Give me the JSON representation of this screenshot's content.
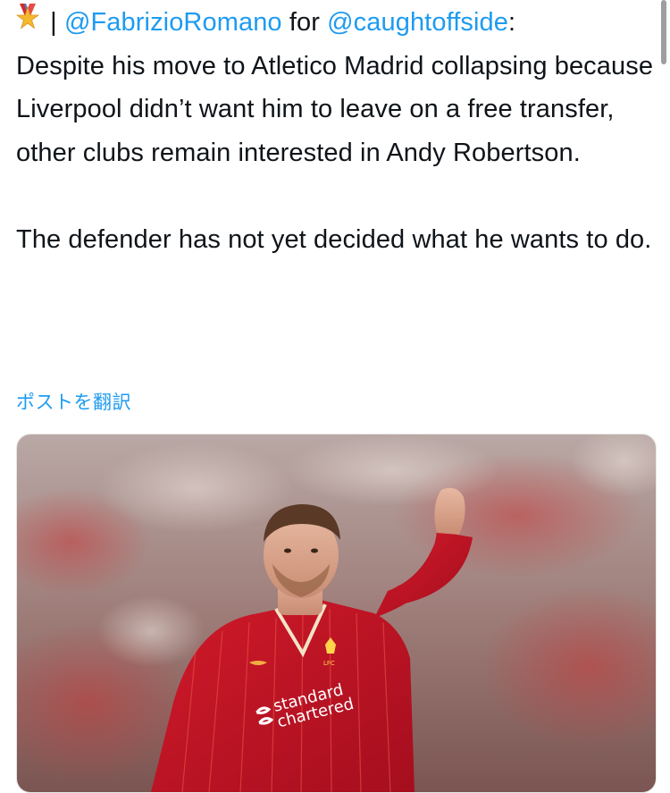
{
  "tweet": {
    "prefix_separator": " | ",
    "mention_author": "@FabrizioRomano",
    "connector": " for ",
    "mention_outlet": "@caughtoffside",
    "after_mention": ":",
    "body_line1": "Despite his move to Atletico Madrid collapsing because Liverpool didn’t want him to leave on a free transfer, other clubs remain interested in Andy Robertson.",
    "body_para2": "The defender has not yet decided what he wants to do."
  },
  "translate_link": "ポストを翻訳",
  "media": {
    "sponsor_line1": "standard",
    "sponsor_line2": "chartered",
    "crest_text": "LFC"
  },
  "colors": {
    "link": "#1d9bf0",
    "text": "#0f1419",
    "kit_red": "#c8102e"
  },
  "icons": {
    "medal": "medal-icon"
  }
}
